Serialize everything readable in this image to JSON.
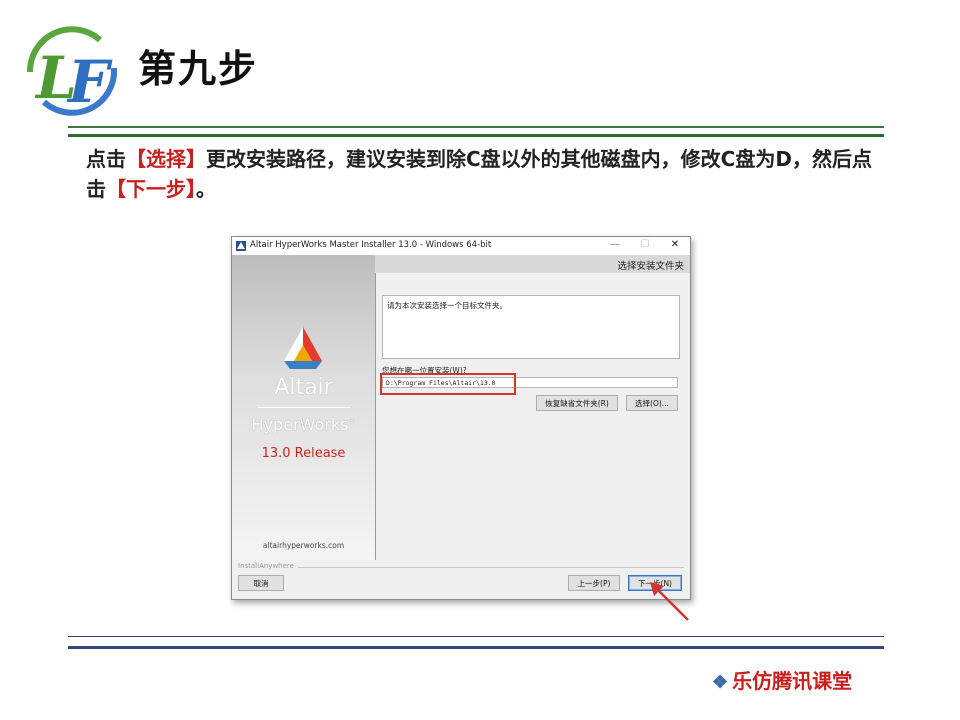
{
  "slide": {
    "logo_text": "LF",
    "title": "第九步",
    "instruction": {
      "part1": "点击",
      "highlight1": "【选择】",
      "part2": "更改安装路径，建议安装到除C盘以外的其他磁盘内，修改C盘为D，然后点击",
      "highlight2": "【下一步】",
      "part3": "。"
    },
    "footer_brand": "乐仿腾讯课堂"
  },
  "window": {
    "title": "Altair HyperWorks Master Installer 13.0 - Windows 64-bit",
    "controls": {
      "minimize": "—",
      "maximize": "☐",
      "close": "✕"
    },
    "step_title": "选择安装文件夹",
    "left_panel": {
      "brand": "Altair",
      "product": "HyperWorks",
      "trademark": "®",
      "release": "13.0 Release",
      "website": "altairhyperworks.com"
    },
    "description": "请为本次安装选择一个目标文件夹。",
    "location_label": "您想在哪一位置安装(W)?",
    "install_path": "D:\\Program Files\\Altair\\13.0",
    "buttons": {
      "restore_default": "恢复缺省文件夹(R)",
      "choose": "选择(O)...",
      "cancel": "取消",
      "previous": "上一步(P)",
      "next": "下一步(N)"
    },
    "installer_brand": "InstallAnywhere"
  },
  "colors": {
    "highlight_red": "#c8201f",
    "green_rule": "#2f6b2e",
    "blue_rule": "#2f4a7a",
    "annotation_red": "#d4332e"
  }
}
